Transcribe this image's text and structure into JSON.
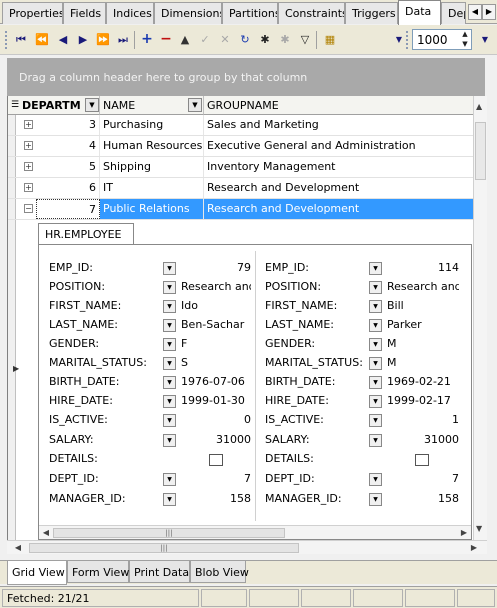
{
  "top_tabs": [
    "Properties",
    "Fields",
    "Indices",
    "Dimensions",
    "Partitions",
    "Constraints",
    "Triggers",
    "Data",
    "Dep"
  ],
  "active_tab": "Data",
  "toolbar": {
    "page_size": "1000"
  },
  "group_panel": {
    "hint": "Drag a column header here to group by that column"
  },
  "grid": {
    "columns": [
      "DEPARTM",
      "NAME",
      "GROUPNAME"
    ],
    "rows": [
      {
        "id": "3",
        "name": "Purchasing",
        "group": "Sales and Marketing"
      },
      {
        "id": "4",
        "name": "Human Resources",
        "group": "Executive General and Administration"
      },
      {
        "id": "5",
        "name": "Shipping",
        "group": "Inventory Management"
      },
      {
        "id": "6",
        "name": "IT",
        "group": "Research and Development"
      },
      {
        "id": "7",
        "name": "Public Relations",
        "group": "Research and Development"
      }
    ],
    "selected_row": 4
  },
  "detail": {
    "tab_label": "HR.EMPLOYEE",
    "labels": [
      "EMP_ID:",
      "POSITION:",
      "FIRST_NAME:",
      "LAST_NAME:",
      "GENDER:",
      "MARITAL_STATUS:",
      "BIRTH_DATE:",
      "HIRE_DATE:",
      "IS_ACTIVE:",
      "SALARY:",
      "DETAILS:",
      "DEPT_ID:",
      "MANAGER_ID:"
    ],
    "records": [
      {
        "values": [
          "79",
          "Research and",
          "Ido",
          "Ben-Sachar",
          "F",
          "S",
          "1976-07-06",
          "1999-01-30",
          "0",
          "31000",
          "",
          "7",
          "158"
        ]
      },
      {
        "values": [
          "114",
          "Research and",
          "Bill",
          "Parker",
          "M",
          "M",
          "1969-02-21",
          "1999-02-17",
          "1",
          "31000",
          "",
          "7",
          "158"
        ]
      }
    ]
  },
  "bottom_tabs": [
    "Grid View",
    "Form View",
    "Print Data",
    "Blob View"
  ],
  "active_bottom_tab": "Grid View",
  "status": {
    "fetched": "Fetched: 21/21"
  },
  "icons": {
    "first": "first-record-icon",
    "prev_page": "prev-page-icon",
    "prev": "prev-record-icon",
    "next": "next-record-icon",
    "next_page": "next-page-icon",
    "last": "last-record-icon",
    "insert": "insert-icon",
    "delete": "delete-icon",
    "edit": "edit-icon",
    "post": "post-icon",
    "cancel": "cancel-icon",
    "refresh": "refresh-icon",
    "bookmark": "bookmark-icon",
    "goto_bookmark": "goto-bookmark-icon",
    "filter": "filter-icon",
    "export": "export-icon"
  },
  "colors": {
    "selection": "#3399ff",
    "group_panel": "#a9a9a9"
  }
}
